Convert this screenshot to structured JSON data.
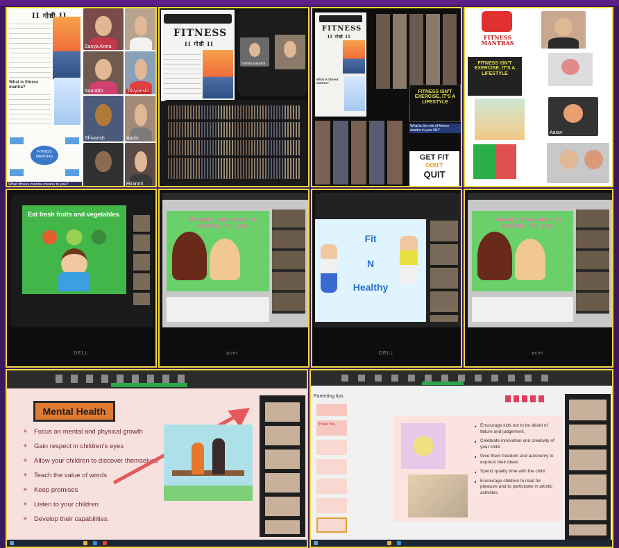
{
  "panel1": {
    "slide_title": "FITNESS",
    "slide_subtitle": "II गोष्ठी II",
    "question": "What is fitness mantra?",
    "bubble_center": "FITNESS MANTRAS",
    "bottom_caption": "What fitness mantra means to you?",
    "tiles": [
      "Sanya Arora",
      "Saurabh",
      "Divyanshi",
      "Shivansh",
      "Aashi",
      "Hiranmi"
    ]
  },
  "panel2": {
    "slide_title": "FITNESS",
    "slide_subtitle": "II गोष्ठी II",
    "tile_top": "Vishnu Gautam",
    "tile_bottom": "Hiranmi"
  },
  "panel3": {
    "slide_title": "FITNESS",
    "slide_subtitle": "II गोष्ठी II",
    "question": "What is fitness mantra?",
    "sign_exercise": "FITNESS ISN'T EXERCISE, IT'S A LIFESTYLE",
    "role_question": "What is the role of fitness mantra in your life?",
    "get_fit": "GET FIT",
    "dont": "DON'T",
    "quit": "QUIT"
  },
  "panel4": {
    "logo_text": "FITNESS MANTRAS",
    "sign_text": "FITNESS ISN'T EXERCISE, IT'S A LIFESTYLE",
    "tile_name": "Aarav"
  },
  "panel5": {
    "caption": "Eat fresh fruits and vegetables.",
    "brand": "DELL"
  },
  "panel6": {
    "caption": "Parents know what is healthy for you.",
    "brand": "acer"
  },
  "panel7": {
    "word1": "Fit",
    "word2": "N",
    "word3": "Healthy",
    "brand": "DELL"
  },
  "panel8": {
    "caption": "Parents know what is healthy for you.",
    "brand": "acer"
  },
  "panel9": {
    "title": "Mental Health",
    "items": [
      "Focus on mental and physical growth",
      "Gain respect in children's eyes",
      "Allow your children to discover themselves",
      "Teach the value of words",
      "Keep promises",
      "Listen to your children",
      "Develop their capabilities."
    ]
  },
  "panel10": {
    "tab": "Parenting tips",
    "thumb_text": "Thank You",
    "bullets": [
      "Encourage kids not to be afraid of failure and judgement.",
      "Celebrate innovation and creativity of your child.",
      "Give them freedom and autonomy to express their ideas.",
      "Spend quality time with the child.",
      "Encourage children to read for pleasure and to participate in artistic activities."
    ]
  },
  "colors": {
    "frame": "#3a1a5e",
    "border": "#f1d83a",
    "mental_title_bg": "#e07a33",
    "green_slide": "#43b64a"
  }
}
